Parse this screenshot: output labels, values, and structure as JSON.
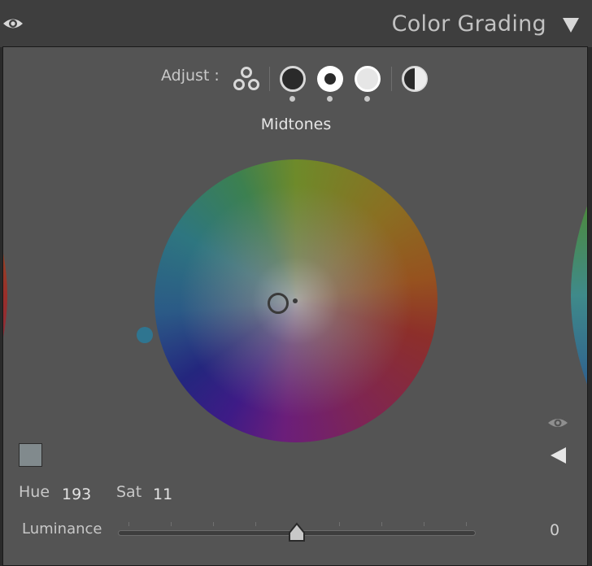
{
  "header": {
    "title": "Color Grading",
    "eye_icon": "eye-icon",
    "collapse_icon": "triangle-down-icon"
  },
  "adjust": {
    "label": "Adjust :",
    "modes": [
      {
        "name": "3-way",
        "icon": "three-circles-icon"
      },
      {
        "name": "shadows",
        "icon": "dark-circle-icon"
      },
      {
        "name": "midtones",
        "icon": "midtone-circle-icon",
        "selected": true
      },
      {
        "name": "highlights",
        "icon": "light-circle-icon"
      },
      {
        "name": "global",
        "icon": "half-circle-icon"
      }
    ]
  },
  "section": {
    "title": "Midtones"
  },
  "controls": {
    "hue_label": "Hue",
    "hue_value": "193",
    "sat_label": "Sat",
    "sat_value": "11",
    "luminance_label": "Luminance",
    "luminance_value": "0",
    "luminance_level": 0.5,
    "swatch_color": "#818a8d"
  },
  "colors": {
    "panel_bg": "#545454",
    "header_bg": "#3e3e3e",
    "hue_handle": "#2f7590"
  }
}
